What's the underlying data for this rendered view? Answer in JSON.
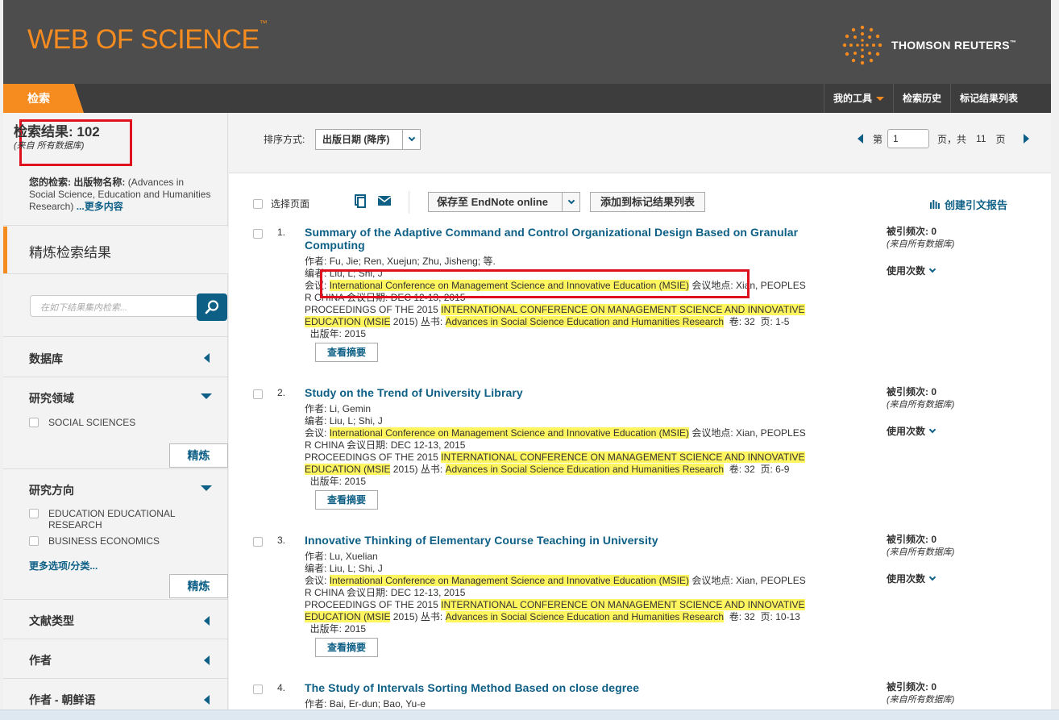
{
  "header": {
    "logo": "WEB OF SCIENCE",
    "logo_tm": "™",
    "brand": "THOMSON REUTERS",
    "brand_tm": "™"
  },
  "nav": {
    "search_tab": "检索",
    "my_tools": "我的工具",
    "search_history": "检索历史",
    "marked_list": "标记结果列表"
  },
  "sidebar": {
    "results_title": "检索结果: 102",
    "results_source": "(来自 所有数据库)",
    "query_label": "您的检索:",
    "query_field": "出版物名称:",
    "query_text": "(Advances in Social Science, Education and Humanities Research)",
    "query_more": "...更多内容",
    "refine_title": "精炼检索结果",
    "search_placeholder": "在如下结果集内检索...",
    "database": "数据库",
    "research_area": "研究领域",
    "research_area_opts": [
      "SOCIAL SCIENCES"
    ],
    "refine_btn": "精炼",
    "research_dir": "研究方向",
    "research_dir_opts": [
      "EDUCATION EDUCATIONAL RESEARCH",
      "BUSINESS ECONOMICS"
    ],
    "more_options": "更多选项/分类...",
    "doc_type": "文献类型",
    "author": "作者",
    "author_korean": "作者 - 朝鲜语"
  },
  "sortbar": {
    "label": "排序方式:",
    "selected": "出版日期 (降序)"
  },
  "pager": {
    "prefix": "第",
    "page": "1",
    "mid": "页，共",
    "total": "11",
    "suffix": "页"
  },
  "toolbar": {
    "select_page": "选择页面",
    "endnote": "保存至 EndNote online",
    "add_marked": "添加到标记结果列表",
    "citation_report": "创建引文报告"
  },
  "labels": {
    "authors": "作者:",
    "editors": "编者:",
    "conference": "会议:",
    "location": "会议地点:",
    "conf_date": "会议日期:",
    "series": "丛书:",
    "volume": "卷:",
    "pages": "页:",
    "pub_year": "出版年:",
    "abstract_btn": "查看摘要",
    "cited": "被引频次:",
    "cited_src": "(来自所有数据库)",
    "usage": "使用次数"
  },
  "records": [
    {
      "num": "1.",
      "title": "Summary of the Adaptive Command and Control Organizational Design Based on Granular Computing",
      "authors": "Fu, Jie; Ren, Xuejun; Zhu, Jisheng; 等.",
      "editors": "Liu, L; Shi, J",
      "conference": "International Conference on Management Science and Innovative Education (MSIE)",
      "location": "Xian, PEOPLES R CHINA",
      "conf_date": "DEC 12-13, 2015",
      "proc_prefix": "PROCEEDINGS OF THE 2015",
      "proc_hl1": "INTERNATIONAL CONFERENCE ON MANAGEMENT SCIENCE AND INNOVATIVE",
      "proc_hl2": "EDUCATION (MSIE",
      "proc_tail": "2015)",
      "series": "Advances in Social Science Education and Humanities Research",
      "volume": "32",
      "pages": "1-5",
      "year": "2015",
      "cited": "0"
    },
    {
      "num": "2.",
      "title": "Study on the Trend of University Library",
      "authors": "Li, Gemin",
      "editors": "Liu, L; Shi, J",
      "conference": "International Conference on Management Science and Innovative Education (MSIE)",
      "location": "Xian, PEOPLES R CHINA",
      "conf_date": "DEC 12-13, 2015",
      "proc_prefix": "PROCEEDINGS OF THE 2015",
      "proc_hl1": "INTERNATIONAL CONFERENCE ON MANAGEMENT SCIENCE AND INNOVATIVE",
      "proc_hl2": "EDUCATION (MSIE",
      "proc_tail": "2015)",
      "series": "Advances in Social Science Education and Humanities Research",
      "volume": "32",
      "pages": "6-9",
      "year": "2015",
      "cited": "0"
    },
    {
      "num": "3.",
      "title": "Innovative Thinking of Elementary Course Teaching in University",
      "authors": "Lu, Xuelian",
      "editors": "Liu, L; Shi, J",
      "conference": "International Conference on Management Science and Innovative Education (MSIE)",
      "location": "Xian, PEOPLES R CHINA",
      "conf_date": "DEC 12-13, 2015",
      "proc_prefix": "PROCEEDINGS OF THE 2015",
      "proc_hl1": "INTERNATIONAL CONFERENCE ON MANAGEMENT SCIENCE AND INNOVATIVE",
      "proc_hl2": "EDUCATION (MSIE",
      "proc_tail": "2015)",
      "series": "Advances in Social Science Education and Humanities Research",
      "volume": "32",
      "pages": "10-13",
      "year": "2015",
      "cited": "0"
    },
    {
      "num": "4.",
      "title": "The Study of Intervals Sorting Method Based on close degree",
      "authors": "Bai, Er-dun; Bao, Yu-e",
      "cited": "0"
    }
  ],
  "colors": {
    "orange": "#f68b1f",
    "header_bg": "#4d4d4d",
    "link": "#0d5f86",
    "highlight": "#fff55e",
    "annotation_red": "#e0111f"
  }
}
